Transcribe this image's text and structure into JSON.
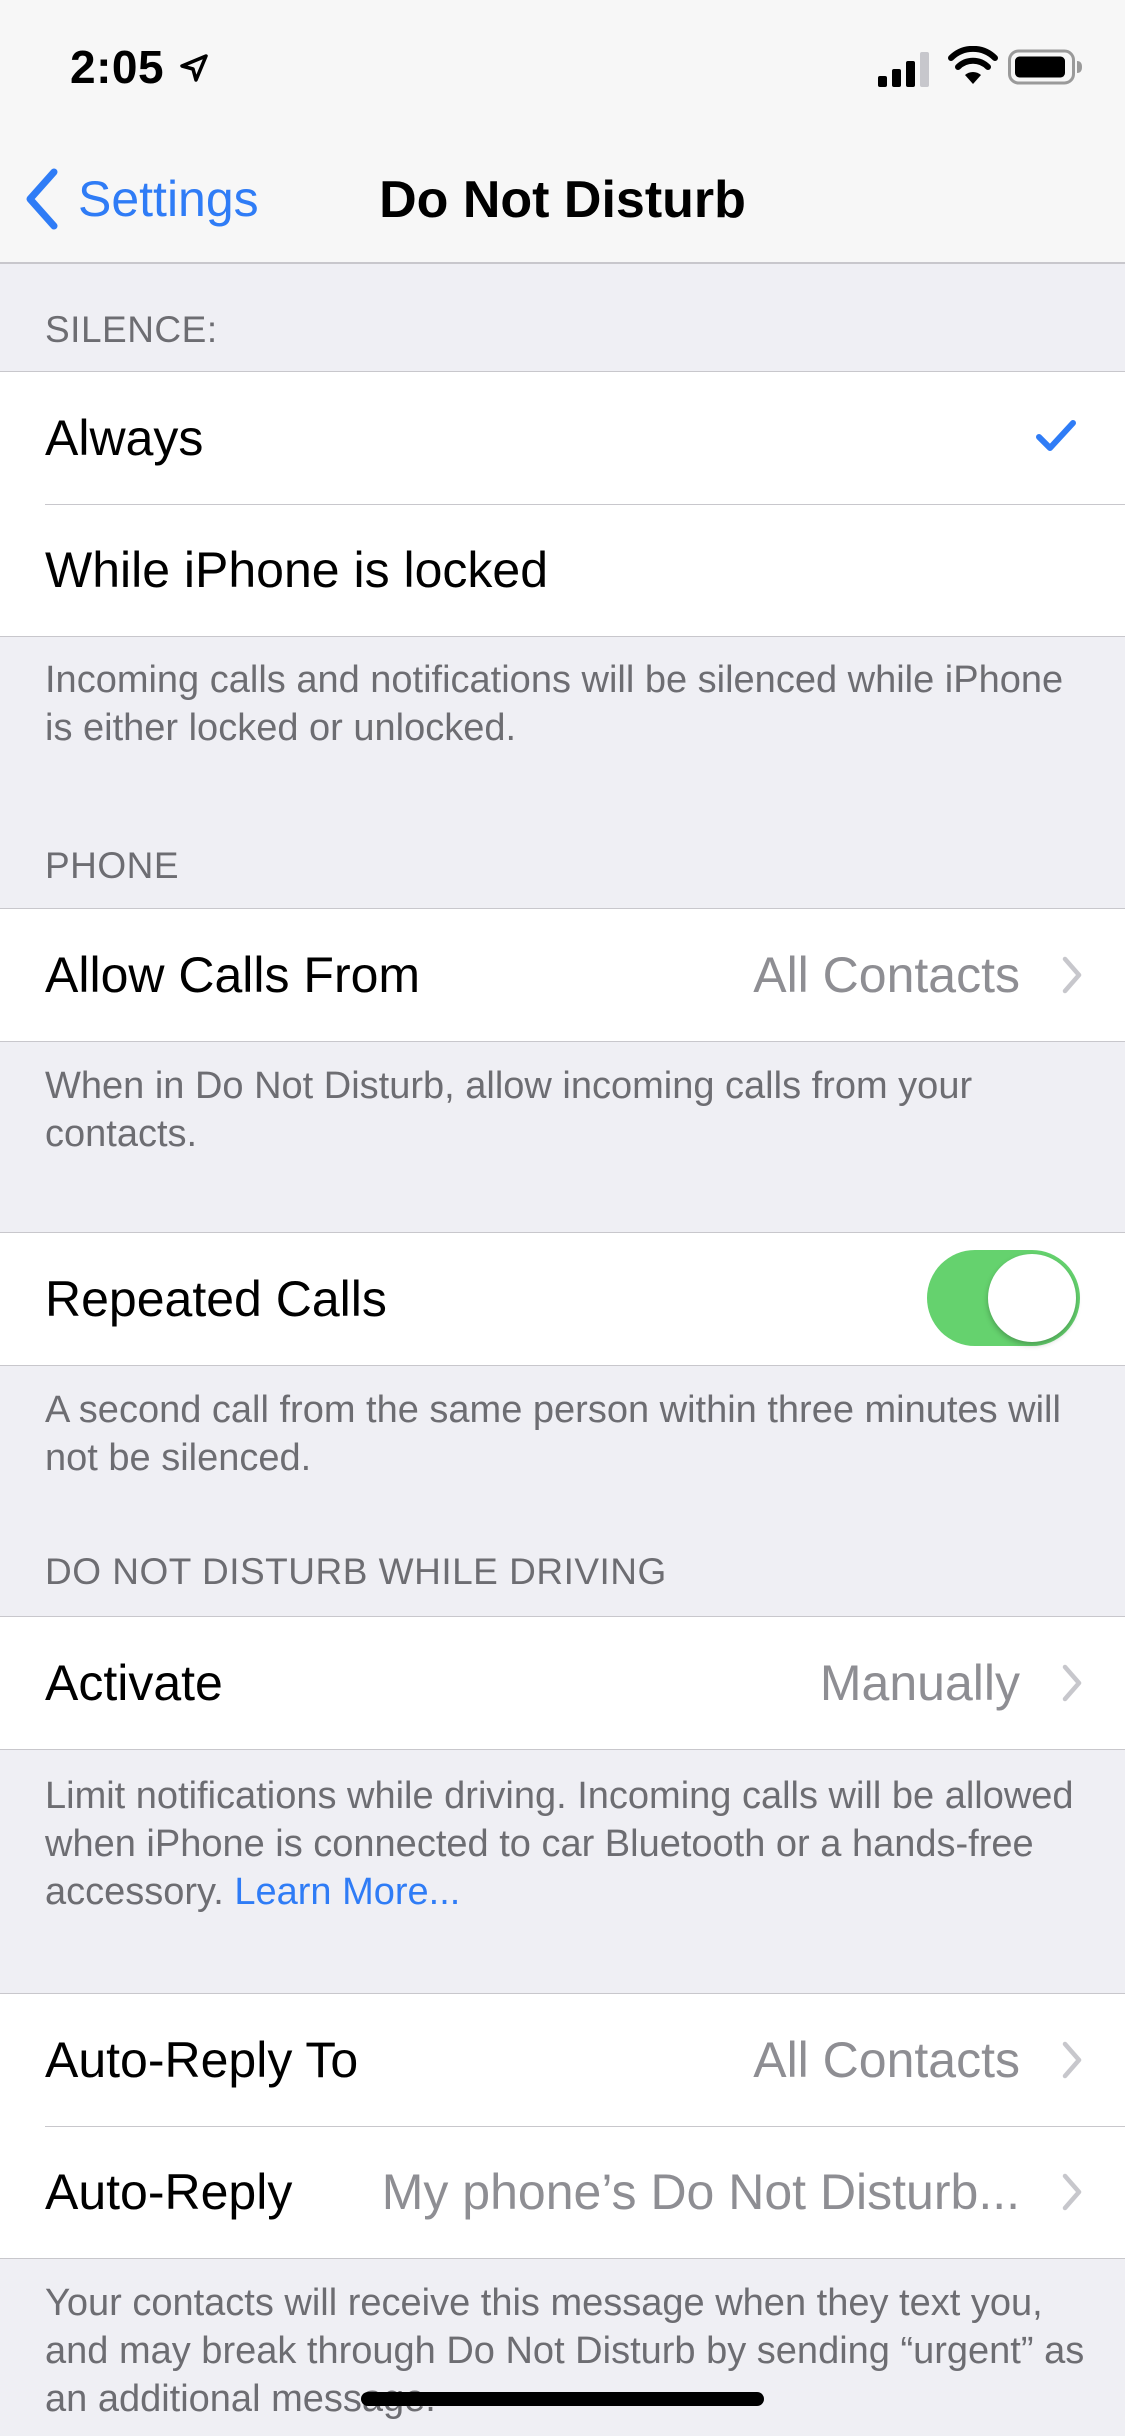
{
  "status_bar": {
    "time": "2:05"
  },
  "nav": {
    "back_label": "Settings",
    "title": "Do Not Disturb"
  },
  "silence": {
    "header": "SILENCE:",
    "options": [
      {
        "label": "Always",
        "selected": true
      },
      {
        "label": "While iPhone is locked",
        "selected": false
      }
    ],
    "footer": "Incoming calls and notifications will be silenced while iPhone is either locked or unlocked."
  },
  "phone": {
    "header": "PHONE",
    "allow_calls": {
      "label": "Allow Calls From",
      "value": "All Contacts"
    },
    "allow_footer": "When in Do Not Disturb, allow incoming calls from your contacts.",
    "repeated_calls": {
      "label": "Repeated Calls",
      "on": true
    },
    "repeated_footer": "A second call from the same person within three minutes will not be silenced."
  },
  "driving": {
    "header": "DO NOT DISTURB WHILE DRIVING",
    "activate": {
      "label": "Activate",
      "value": "Manually"
    },
    "footer_text": "Limit notifications while driving. Incoming calls will be allowed when iPhone is connected to car Bluetooth or a hands-free accessory.",
    "footer_link": "Learn More...",
    "auto_reply_to": {
      "label": "Auto-Reply To",
      "value": "All Contacts"
    },
    "auto_reply": {
      "label": "Auto-Reply",
      "value": "My phone’s Do Not Disturb..."
    },
    "auto_reply_footer": "Your contacts will receive this message when they text you, and may break through Do Not Disturb by sending “urgent” as an additional message."
  },
  "colors": {
    "accent": "#2f7cf6",
    "toggle_on": "#65d26e",
    "background": "#efeff4",
    "secondary_text": "#8e8e93"
  }
}
